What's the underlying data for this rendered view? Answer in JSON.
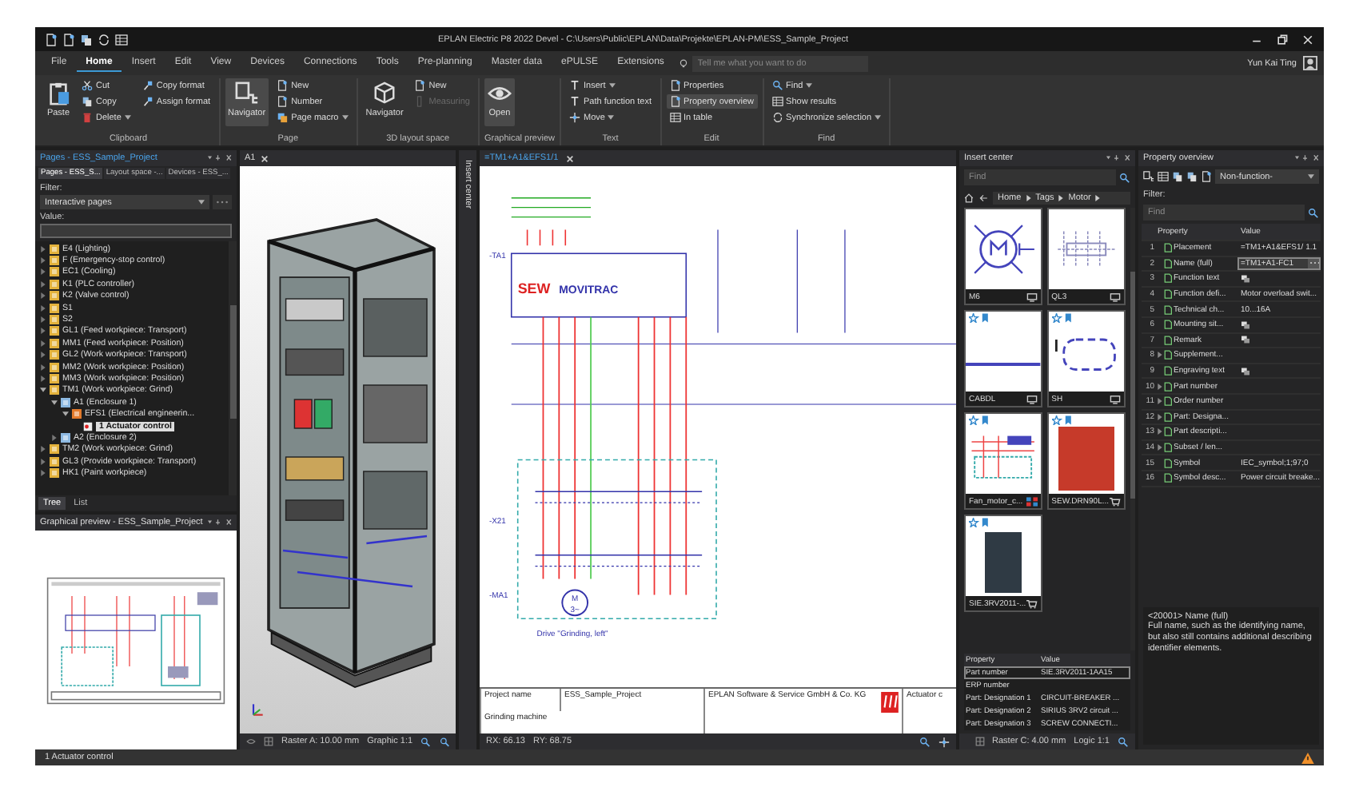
{
  "window": {
    "title": "EPLAN Electric P8 2022 Devel - C:\\Users\\Public\\EPLAN\\Data\\Projekte\\EPLAN-PM\\ESS_Sample_Project"
  },
  "menu_tabs": [
    {
      "label": "File",
      "selected": false
    },
    {
      "label": "Home",
      "selected": true
    },
    {
      "label": "Insert",
      "selected": false
    },
    {
      "label": "Edit",
      "selected": false
    },
    {
      "label": "View",
      "selected": false
    },
    {
      "label": "Devices",
      "selected": false
    },
    {
      "label": "Connections",
      "selected": false
    },
    {
      "label": "Tools",
      "selected": false
    },
    {
      "label": "Pre-planning",
      "selected": false
    },
    {
      "label": "Master data",
      "selected": false
    },
    {
      "label": "ePULSE",
      "selected": false
    },
    {
      "label": "Extensions",
      "selected": false
    }
  ],
  "search": {
    "placeholder": "Tell me what you want to do"
  },
  "user": {
    "name": "Yun Kai Ting"
  },
  "ribbon": [
    {
      "label": "Clipboard",
      "items": [
        {
          "label": "Paste",
          "kind": "large",
          "selected": false,
          "disabled": false,
          "has_menu": false
        },
        {
          "label": "Cut",
          "kind": "small",
          "selected": false,
          "disabled": false,
          "has_menu": false
        },
        {
          "label": "Copy",
          "kind": "small",
          "selected": false,
          "disabled": false,
          "has_menu": false
        },
        {
          "label": "Delete",
          "kind": "small",
          "selected": false,
          "disabled": false,
          "has_menu": true
        },
        {
          "label": "Copy format",
          "kind": "small",
          "selected": false,
          "disabled": false,
          "has_menu": false
        },
        {
          "label": "Assign format",
          "kind": "small",
          "selected": false,
          "disabled": false,
          "has_menu": false
        }
      ]
    },
    {
      "label": "Page",
      "items": [
        {
          "label": "Navigator",
          "kind": "large",
          "selected": true,
          "disabled": false,
          "has_menu": false
        },
        {
          "label": "New",
          "kind": "small",
          "selected": false,
          "disabled": false,
          "has_menu": false
        },
        {
          "label": "Number",
          "kind": "small",
          "selected": false,
          "disabled": false,
          "has_menu": false
        },
        {
          "label": "Page macro",
          "kind": "small",
          "selected": false,
          "disabled": false,
          "has_menu": true
        }
      ]
    },
    {
      "label": "3D layout space",
      "items": [
        {
          "label": "Navigator",
          "kind": "large",
          "selected": false,
          "disabled": false,
          "has_menu": false
        },
        {
          "label": "New",
          "kind": "small",
          "selected": false,
          "disabled": false,
          "has_menu": false
        },
        {
          "label": "Measuring",
          "kind": "small",
          "selected": false,
          "disabled": true,
          "has_menu": false
        }
      ]
    },
    {
      "label": "Graphical preview",
      "items": [
        {
          "label": "Open",
          "kind": "large",
          "selected": true,
          "disabled": false,
          "has_menu": false
        }
      ]
    },
    {
      "label": "Text",
      "items": [
        {
          "label": "Insert",
          "kind": "small",
          "selected": false,
          "disabled": false,
          "has_menu": true
        },
        {
          "label": "Path function text",
          "kind": "small",
          "selected": false,
          "disabled": false,
          "has_menu": false
        },
        {
          "label": "Move",
          "kind": "small",
          "selected": false,
          "disabled": false,
          "has_menu": true
        }
      ]
    },
    {
      "label": "Edit",
      "items": [
        {
          "label": "Properties",
          "kind": "small",
          "selected": false,
          "disabled": false,
          "has_menu": false
        },
        {
          "label": "Property overview",
          "kind": "small",
          "selected": true,
          "disabled": false,
          "has_menu": false
        },
        {
          "label": "In table",
          "kind": "small",
          "selected": false,
          "disabled": false,
          "has_menu": false
        }
      ]
    },
    {
      "label": "Find",
      "items": [
        {
          "label": "Find",
          "kind": "small",
          "selected": false,
          "disabled": false,
          "has_menu": true
        },
        {
          "label": "Show results",
          "kind": "small",
          "selected": false,
          "disabled": false,
          "has_menu": false
        },
        {
          "label": "Synchronize selection",
          "kind": "small",
          "selected": false,
          "disabled": false,
          "has_menu": true
        }
      ]
    }
  ],
  "pages_panel": {
    "title": "Pages - ESS_Sample_Project",
    "tabs": [
      {
        "label": "Pages - ESS_S...",
        "selected": true
      },
      {
        "label": "Layout space -...",
        "selected": false
      },
      {
        "label": "Devices - ESS_...",
        "selected": false
      }
    ],
    "filter_label": "Filter:",
    "filter_value": "Interactive pages",
    "value_label": "Value:",
    "tree": [
      {
        "label": "E4 (Lighting)",
        "kind": "function",
        "expanded": false,
        "selected": false
      },
      {
        "label": "F (Emergency-stop control)",
        "kind": "function",
        "expanded": false,
        "selected": false
      },
      {
        "label": "EC1 (Cooling)",
        "kind": "function",
        "expanded": false,
        "selected": false
      },
      {
        "label": "K1 (PLC controller)",
        "kind": "function",
        "expanded": false,
        "selected": false
      },
      {
        "label": "K2 (Valve control)",
        "kind": "function",
        "expanded": false,
        "selected": false
      },
      {
        "label": "S1",
        "kind": "function",
        "expanded": false,
        "selected": false
      },
      {
        "label": "S2",
        "kind": "function",
        "expanded": false,
        "selected": false
      },
      {
        "label": "GL1 (Feed workpiece: Transport)",
        "kind": "function",
        "expanded": false,
        "selected": false
      },
      {
        "label": "MM1 (Feed workpiece: Position)",
        "kind": "function",
        "expanded": false,
        "selected": false
      },
      {
        "label": "GL2 (Work workpiece: Transport)",
        "kind": "function",
        "expanded": false,
        "selected": false
      },
      {
        "label": "MM2 (Work workpiece: Position)",
        "kind": "function",
        "expanded": false,
        "selected": false
      },
      {
        "label": "MM3 (Work workpiece: Position)",
        "kind": "function",
        "expanded": false,
        "selected": false
      },
      {
        "label": "TM1 (Work workpiece: Grind)",
        "kind": "function",
        "expanded": true,
        "selected": false,
        "children": [
          {
            "label": "A1 (Enclosure 1)",
            "kind": "location",
            "expanded": true,
            "selected": false,
            "children": [
              {
                "label": "EFS1 (Electrical engineerin...",
                "kind": "document",
                "expanded": true,
                "selected": false,
                "children": [
                  {
                    "label": "1 Actuator control",
                    "kind": "page",
                    "selected": true
                  }
                ]
              }
            ]
          },
          {
            "label": "A2 (Enclosure 2)",
            "kind": "location",
            "expanded": false,
            "selected": false
          }
        ]
      },
      {
        "label": "TM2 (Work workpiece: Grind)",
        "kind": "function",
        "expanded": false,
        "selected": false
      },
      {
        "label": "GL3 (Provide workpiece: Transport)",
        "kind": "function",
        "expanded": false,
        "selected": false
      },
      {
        "label": "HK1 (Paint workpiece)",
        "kind": "function",
        "expanded": false,
        "selected": false
      }
    ],
    "bottom_tabs": [
      {
        "label": "Tree",
        "selected": true
      },
      {
        "label": "List",
        "selected": false
      }
    ]
  },
  "preview_panel": {
    "title": "Graphical preview - ESS_Sample_Project"
  },
  "layout_view": {
    "tab": "A1",
    "side_tab": "Insert center",
    "status": [
      "Raster A: 10.00 mm",
      "Graphic 1:1"
    ]
  },
  "schematic": {
    "tab": "=TM1+A1&EFS1/1",
    "labels": [
      {
        "kind": "device",
        "text": "-TA1"
      },
      {
        "kind": "brand",
        "text": "SEW"
      },
      {
        "kind": "product",
        "text": "MOVITRAC"
      },
      {
        "kind": "device",
        "text": "-X21"
      },
      {
        "kind": "device",
        "text": "-MA1"
      },
      {
        "kind": "motor_m",
        "text": "M"
      },
      {
        "kind": "motor_phase",
        "text": "3~"
      },
      {
        "kind": "caption",
        "text": "Drive \"Grinding, left\""
      }
    ],
    "title_block": {
      "project_label": "Project name",
      "project": "ESS_Sample_Project",
      "description": "Grinding machine",
      "company": "EPLAN Software & Service GmbH & Co. KG",
      "page_title": "Actuator c"
    },
    "status": [
      "RX: 66.13",
      "RY: 68.75"
    ]
  },
  "insert_center": {
    "title": "Insert center",
    "search_placeholder": "Find",
    "breadcrumb": [
      "Home",
      "Tags",
      "Motor"
    ],
    "tiles": [
      {
        "label": "M6",
        "kind": "symbol",
        "starred": false
      },
      {
        "label": "QL3",
        "kind": "symbol",
        "starred": false
      },
      {
        "label": "CABDL",
        "kind": "symbol",
        "starred": true
      },
      {
        "label": "SH",
        "kind": "symbol",
        "starred": true
      },
      {
        "label": "Fan_motor_c...",
        "kind": "macro",
        "starred": true
      },
      {
        "label": "SEW.DRN90L...",
        "kind": "part",
        "starred": true
      },
      {
        "label": "SIE.3RV2011-...",
        "kind": "part",
        "starred": true
      }
    ],
    "properties": {
      "columns": [
        "Property",
        "Value"
      ],
      "rows": [
        {
          "property": "Part number",
          "value": "SIE.3RV2011-1AA15",
          "selected": true
        },
        {
          "property": "ERP number",
          "selected": false
        },
        {
          "property": "Part: Designation 1",
          "value": "CIRCUIT-BREAKER ...",
          "selected": false
        },
        {
          "property": "Part: Designation 2",
          "value": "SIRIUS 3RV2 circuit ...",
          "selected": false
        },
        {
          "property": "Part: Designation 3",
          "value": "SCREW CONNECTI...",
          "selected": false
        }
      ]
    },
    "status": [
      "Raster C: 4.00 mm",
      "Logic 1:1"
    ]
  },
  "property_overview": {
    "title": "Property overview",
    "dropdown": "Non-function-",
    "filter_label": "Filter:",
    "search_placeholder": "Find",
    "columns": [
      "Property",
      "Value"
    ],
    "rows": [
      {
        "num": "1",
        "property": "Placement",
        "value": "=TM1+A1&EFS1/ 1.1",
        "expandable": false,
        "editing": false
      },
      {
        "num": "2",
        "property": "Name (full)",
        "value": "=TM1+A1-FC1",
        "expandable": false,
        "editing": true
      },
      {
        "num": "3",
        "property": "Function text",
        "multilang": true,
        "expandable": false,
        "editing": false
      },
      {
        "num": "4",
        "property": "Function defi...",
        "value": "Motor overload swit...",
        "expandable": false,
        "editing": false
      },
      {
        "num": "5",
        "property": "Technical ch...",
        "value": "10...16A",
        "expandable": false,
        "editing": false
      },
      {
        "num": "6",
        "property": "Mounting sit...",
        "multilang": true,
        "expandable": false,
        "editing": false
      },
      {
        "num": "7",
        "property": "Remark",
        "multilang": true,
        "expandable": false,
        "editing": false
      },
      {
        "num": "8",
        "property": "Supplement...",
        "multilang": false,
        "expandable": true,
        "editing": false
      },
      {
        "num": "9",
        "property": "Engraving text",
        "multilang": true,
        "expandable": false,
        "editing": false
      },
      {
        "num": "10",
        "property": "Part number",
        "multilang": false,
        "expandable": true,
        "editing": false
      },
      {
        "num": "11",
        "property": "Order number",
        "multilang": false,
        "expandable": true,
        "editing": false
      },
      {
        "num": "12",
        "property": "Part: Designa...",
        "multilang": false,
        "expandable": true,
        "editing": false
      },
      {
        "num": "13",
        "property": "Part descripti...",
        "multilang": false,
        "expandable": true,
        "editing": false
      },
      {
        "num": "14",
        "property": "Subset / len...",
        "multilang": false,
        "expandable": true,
        "editing": false
      },
      {
        "num": "15",
        "property": "Symbol",
        "value": "IEC_symbol;1;97;0",
        "expandable": false,
        "editing": false
      },
      {
        "num": "16",
        "property": "Symbol desc...",
        "value": "Power circuit breake...",
        "expandable": false,
        "editing": false
      }
    ],
    "description_title": "<20001> Name (full)",
    "description": "Full name, such as the identifying name, but also still contains additional describing identifier elements."
  },
  "status_bar": {
    "text": "1 Actuator control",
    "warning": true
  }
}
